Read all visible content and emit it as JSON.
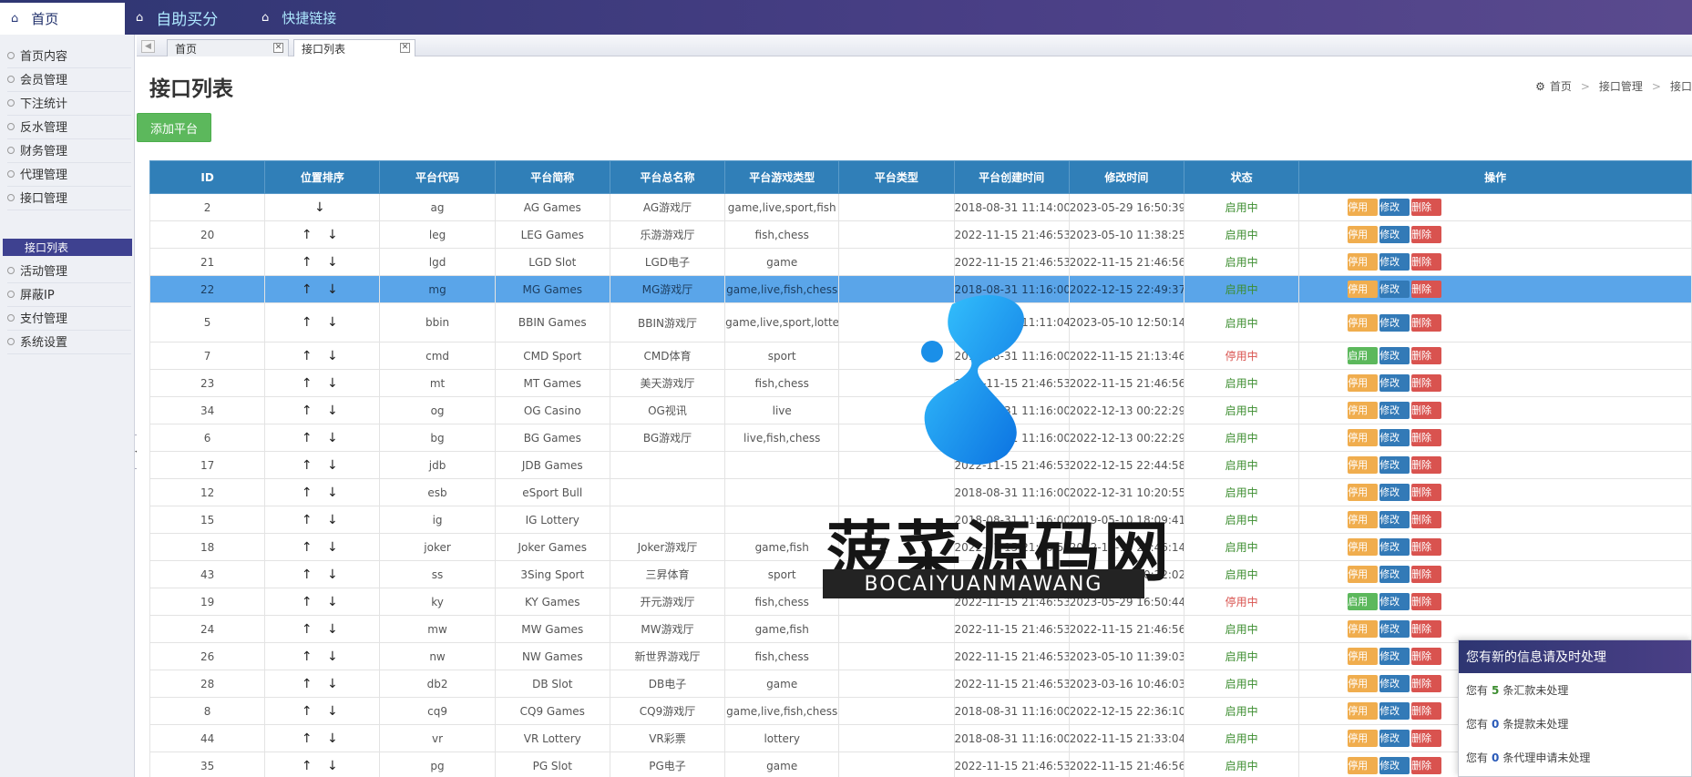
{
  "topbar": {
    "home_label": "首页",
    "buy_label": "自助买分",
    "quick_label": "快捷链接"
  },
  "sidebar": {
    "items": [
      {
        "label": "首页内容"
      },
      {
        "label": "会员管理"
      },
      {
        "label": "下注统计"
      },
      {
        "label": "反水管理"
      },
      {
        "label": "财务管理"
      },
      {
        "label": "代理管理"
      },
      {
        "label": "接口管理"
      },
      {
        "label": "活动管理"
      },
      {
        "label": "屏蔽IP"
      },
      {
        "label": "支付管理"
      },
      {
        "label": "系统设置"
      }
    ],
    "active_sub": "接口列表"
  },
  "tabs": [
    {
      "label": "首页"
    },
    {
      "label": "接口列表"
    }
  ],
  "page": {
    "title": "接口列表",
    "add_button": "添加平台"
  },
  "breadcrumb": [
    "首页",
    "接口管理",
    "接口"
  ],
  "table": {
    "headers": [
      "ID",
      "位置排序",
      "平台代码",
      "平台简称",
      "平台总名称",
      "平台游戏类型",
      "平台类型",
      "平台创建时间",
      "修改时间",
      "状态",
      "操作"
    ],
    "rows": [
      {
        "id": "2",
        "sort": "↓",
        "code": "ag",
        "short": "AG Games",
        "name": "AG游戏厅",
        "types": "game,live,sport,fish",
        "ptype": "",
        "created": "2018-08-31 11:14:00",
        "modified": "2023-05-29 16:50:39",
        "status": "启用中",
        "toggle": "停用"
      },
      {
        "id": "20",
        "sort": "↑ ↓",
        "code": "leg",
        "short": "LEG Games",
        "name": "乐游游戏厅",
        "types": "fish,chess",
        "ptype": "",
        "created": "2022-11-15 21:46:53",
        "modified": "2023-05-10 11:38:25",
        "status": "启用中",
        "toggle": "停用"
      },
      {
        "id": "21",
        "sort": "↑ ↓",
        "code": "lgd",
        "short": "LGD Slot",
        "name": "LGD电子",
        "types": "game",
        "ptype": "",
        "created": "2022-11-15 21:46:53",
        "modified": "2022-11-15 21:46:56",
        "status": "启用中",
        "toggle": "停用"
      },
      {
        "id": "22",
        "sort": "↑ ↓",
        "code": "mg",
        "short": "MG Games",
        "name": "MG游戏厅",
        "types": "game,live,fish,chess",
        "ptype": "",
        "created": "2018-08-31 11:16:00",
        "modified": "2022-12-15 22:49:37",
        "status": "启用中",
        "toggle": "停用"
      },
      {
        "id": "5",
        "sort": "↑ ↓",
        "code": "bbin",
        "short": "BBIN Games",
        "name": "BBIN游戏厅",
        "types": "game,live,sport,lottery,fish,chess",
        "ptype": "",
        "created": "2018-08-31 11:11:04",
        "modified": "2023-05-10 12:50:14",
        "status": "启用中",
        "toggle": "停用"
      },
      {
        "id": "7",
        "sort": "↑ ↓",
        "code": "cmd",
        "short": "CMD Sport",
        "name": "CMD体育",
        "types": "sport",
        "ptype": "",
        "created": "2018-08-31 11:16:00",
        "modified": "2022-11-15 21:13:46",
        "status": "停用中",
        "toggle": "启用"
      },
      {
        "id": "23",
        "sort": "↑ ↓",
        "code": "mt",
        "short": "MT Games",
        "name": "美天游戏厅",
        "types": "fish,chess",
        "ptype": "",
        "created": "2022-11-15 21:46:53",
        "modified": "2022-11-15 21:46:56",
        "status": "启用中",
        "toggle": "停用"
      },
      {
        "id": "34",
        "sort": "↑ ↓",
        "code": "og",
        "short": "OG Casino",
        "name": "OG视讯",
        "types": "live",
        "ptype": "",
        "created": "2018-08-31 11:16:00",
        "modified": "2022-12-13 00:22:29",
        "status": "启用中",
        "toggle": "停用"
      },
      {
        "id": "6",
        "sort": "↑ ↓",
        "code": "bg",
        "short": "BG Games",
        "name": "BG游戏厅",
        "types": "live,fish,chess",
        "ptype": "",
        "created": "2018-08-31 11:16:00",
        "modified": "2022-12-13 00:22:29",
        "status": "启用中",
        "toggle": "停用"
      },
      {
        "id": "17",
        "sort": "↑ ↓",
        "code": "jdb",
        "short": "JDB Games",
        "name": "",
        "types": "",
        "ptype": "",
        "created": "2022-11-15 21:46:53",
        "modified": "2022-12-15 22:44:58",
        "status": "启用中",
        "toggle": "停用"
      },
      {
        "id": "12",
        "sort": "↑ ↓",
        "code": "esb",
        "short": "eSport Bull",
        "name": "",
        "types": "",
        "ptype": "",
        "created": "2018-08-31 11:16:00",
        "modified": "2022-12-31 10:20:55",
        "status": "启用中",
        "toggle": "停用"
      },
      {
        "id": "15",
        "sort": "↑ ↓",
        "code": "ig",
        "short": "IG Lottery",
        "name": "",
        "types": "",
        "ptype": "",
        "created": "2018-08-31 11:16:00",
        "modified": "2019-05-10 18:09:41",
        "status": "启用中",
        "toggle": "停用"
      },
      {
        "id": "18",
        "sort": "↑ ↓",
        "code": "joker",
        "short": "Joker Games",
        "name": "Joker游戏厅",
        "types": "game,fish",
        "ptype": "",
        "created": "2022-11-15 21:46:53",
        "modified": "2022-12-15 22:46:14",
        "status": "启用中",
        "toggle": "停用"
      },
      {
        "id": "43",
        "sort": "↑ ↓",
        "code": "ss",
        "short": "3Sing Sport",
        "name": "三昇体育",
        "types": "sport",
        "ptype": "",
        "created": "2018-08-31 11:16:00",
        "modified": "2022-12-13 00:22:02",
        "status": "启用中",
        "toggle": "停用"
      },
      {
        "id": "19",
        "sort": "↑ ↓",
        "code": "ky",
        "short": "KY Games",
        "name": "开元游戏厅",
        "types": "fish,chess",
        "ptype": "",
        "created": "2022-11-15 21:46:53",
        "modified": "2023-05-29 16:50:44",
        "status": "停用中",
        "toggle": "启用"
      },
      {
        "id": "24",
        "sort": "↑ ↓",
        "code": "mw",
        "short": "MW Games",
        "name": "MW游戏厅",
        "types": "game,fish",
        "ptype": "",
        "created": "2022-11-15 21:46:53",
        "modified": "2022-11-15 21:46:56",
        "status": "启用中",
        "toggle": "停用"
      },
      {
        "id": "26",
        "sort": "↑ ↓",
        "code": "nw",
        "short": "NW Games",
        "name": "新世界游戏厅",
        "types": "fish,chess",
        "ptype": "",
        "created": "2022-11-15 21:46:53",
        "modified": "2023-05-10 11:39:03",
        "status": "启用中",
        "toggle": "停用"
      },
      {
        "id": "28",
        "sort": "↑ ↓",
        "code": "db2",
        "short": "DB Slot",
        "name": "DB电子",
        "types": "game",
        "ptype": "",
        "created": "2022-11-15 21:46:53",
        "modified": "2023-03-16 10:46:03",
        "status": "启用中",
        "toggle": "停用"
      },
      {
        "id": "8",
        "sort": "↑ ↓",
        "code": "cq9",
        "short": "CQ9 Games",
        "name": "CQ9游戏厅",
        "types": "game,live,fish,chess",
        "ptype": "",
        "created": "2018-08-31 11:16:00",
        "modified": "2022-12-15 22:36:10",
        "status": "启用中",
        "toggle": "停用"
      },
      {
        "id": "44",
        "sort": "↑ ↓",
        "code": "vr",
        "short": "VR Lottery",
        "name": "VR彩票",
        "types": "lottery",
        "ptype": "",
        "created": "2018-08-31 11:16:00",
        "modified": "2022-11-15 21:33:04",
        "status": "启用中",
        "toggle": "停用"
      },
      {
        "id": "35",
        "sort": "↑ ↓",
        "code": "pg",
        "short": "PG Slot",
        "name": "PG电子",
        "types": "game",
        "ptype": "",
        "created": "2022-11-15 21:46:53",
        "modified": "2022-11-15 21:46:56",
        "status": "启用中",
        "toggle": "停用"
      }
    ],
    "edit_label": "修改",
    "delete_label": "删除"
  },
  "watermark": {
    "title": "菠菜源码网",
    "subtitle": "BOCAIYUANMAWANG"
  },
  "notify": {
    "title": "您有新的信息请及时处理",
    "lines": [
      {
        "prefix": "您有",
        "count": "5",
        "suffix": "条汇款未处理"
      },
      {
        "prefix": "您有",
        "count": "0",
        "suffix": "条提款未处理"
      },
      {
        "prefix": "您有",
        "count": "0",
        "suffix": "条代理申请未处理"
      }
    ]
  },
  "colors": {
    "header_blue": "#307fb8",
    "highlight_row": "#5aa5e9",
    "status_on": "#3c8d2f",
    "status_off": "#d9534f",
    "stop_button": "#f0ad4e",
    "start_button": "#5cb85c",
    "edit_button": "#337ab7",
    "delete_button": "#d9534f"
  }
}
